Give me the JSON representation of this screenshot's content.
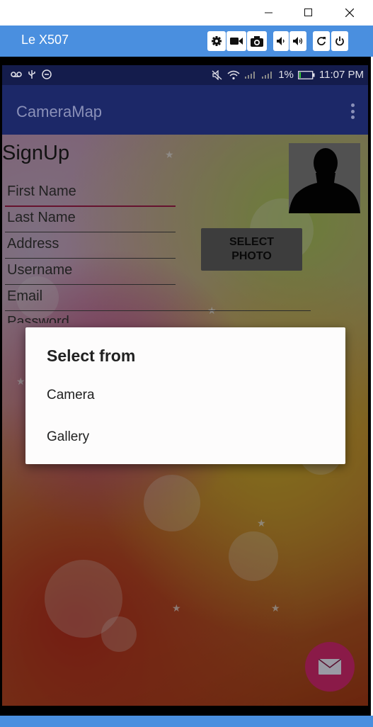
{
  "window": {
    "minimize_label": "minimize",
    "maximize_label": "maximize",
    "close_label": "close"
  },
  "vysor": {
    "device_name": "Le X507",
    "buttons": [
      "settings",
      "record",
      "screenshot",
      "volume-down",
      "volume-up",
      "rotate",
      "power"
    ]
  },
  "statusbar": {
    "battery": "1%",
    "time": "11:07 PM"
  },
  "app": {
    "title": "CameraMap"
  },
  "form": {
    "title": "SignUp",
    "first_name": "First Name",
    "last_name": "Last Name",
    "address": "Address",
    "username": "Username",
    "email": "Email",
    "password": "Password",
    "select_photo_line1": "SELECT",
    "select_photo_line2": "PHOTO"
  },
  "dialog": {
    "title": "Select from",
    "items": [
      "Camera",
      "Gallery"
    ]
  },
  "colors": {
    "vysor_blue": "#4a8fdf",
    "appbar": "#1c2868",
    "accent": "#b02050",
    "fab": "#8a1a48"
  }
}
